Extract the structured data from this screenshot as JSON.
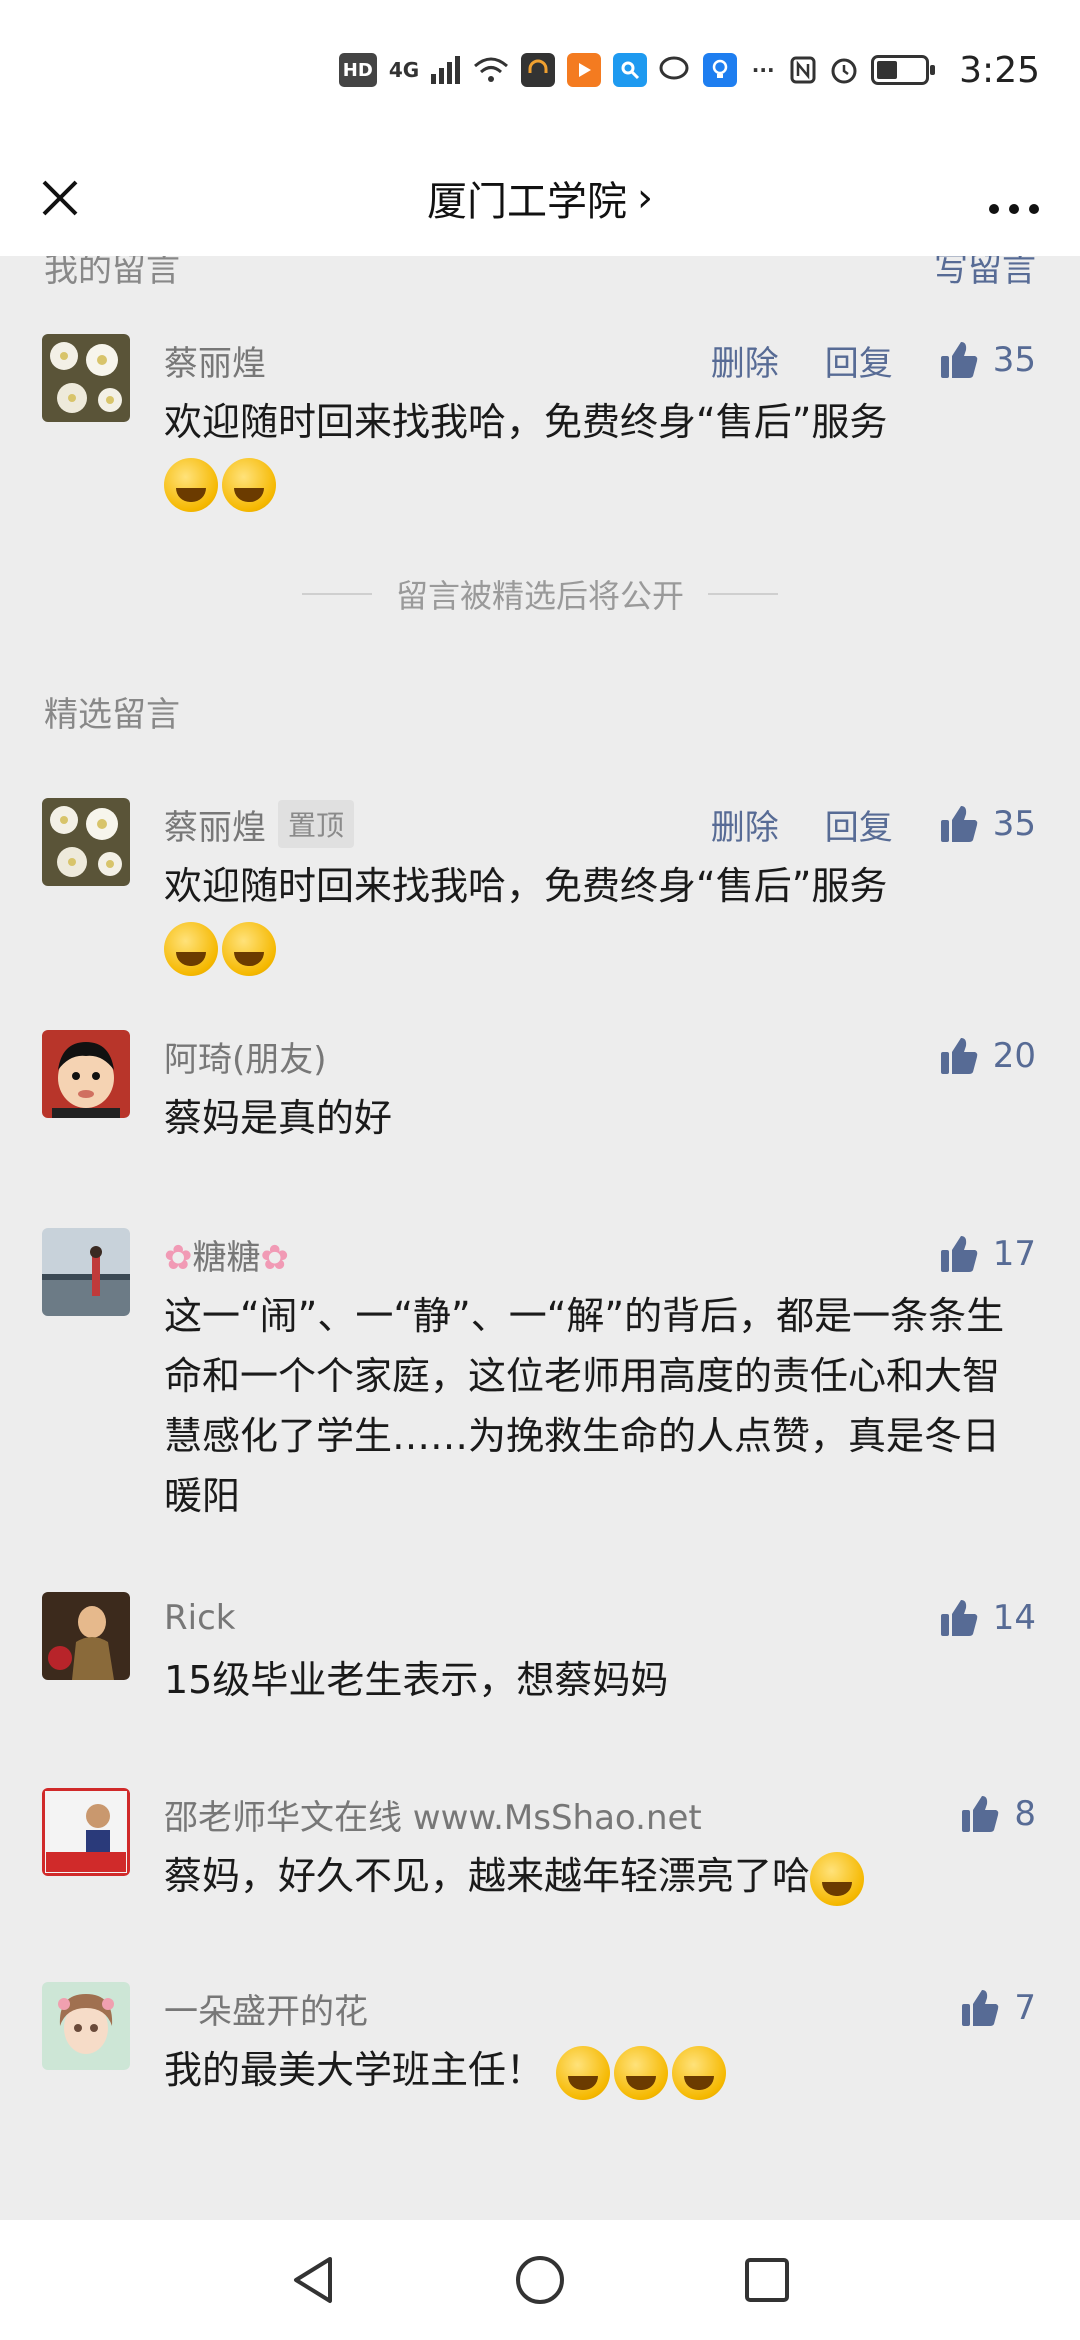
{
  "status_bar": {
    "network": "4G",
    "hd": "HD",
    "time": "3:25",
    "icons": [
      "hd-icon",
      "signal-icon",
      "wifi-icon",
      "headphones-icon",
      "video-icon",
      "search-app-icon",
      "chat-icon",
      "bulb-icon",
      "more-icon",
      "nfc-icon",
      "alarm-icon",
      "battery-icon"
    ]
  },
  "nav": {
    "title": "厦门工学院",
    "chevron": "›",
    "close_icon": "close-icon",
    "more_icon": "more-icon"
  },
  "my_section": {
    "title": "我的留言",
    "write_link": "写留言"
  },
  "my_comment": {
    "name": "蔡丽煌",
    "delete_label": "删除",
    "reply_label": "回复",
    "likes": "35",
    "text": "欢迎随时回来找我哈，免费终身“售后”服务"
  },
  "note": "留言被精选后将公开",
  "featured_section": {
    "title": "精选留言"
  },
  "comments": [
    {
      "name": "蔡丽煌",
      "tag": "置顶",
      "delete_label": "删除",
      "reply_label": "回复",
      "likes": "35",
      "text": "欢迎随时回来找我哈，免费终身“售后”服务"
    },
    {
      "name": "阿琦(朋友)",
      "likes": "20",
      "text": "蔡妈是真的好"
    },
    {
      "name": "糖糖",
      "likes": "17",
      "text": "这一“闹”、一“静”、一“解”的背后，都是一条条生命和一个个家庭，这位老师用高度的责任心和大智慧感化了学生……为挽救生命的人点赞，真是冬日暖阳"
    },
    {
      "name": "Rick",
      "likes": "14",
      "text": "15级毕业老生表示，想蔡妈妈"
    },
    {
      "name": "邵老师华文在线 www.MsShao.net",
      "likes": "8",
      "text": "蔡妈，好久不见，越来越年轻漂亮了哈"
    },
    {
      "name": "一朵盛开的花",
      "likes": "7",
      "text": "我的最美大学班主任！"
    }
  ],
  "colors": {
    "link": "#576b95",
    "background": "#ededed",
    "text": "#1a1a1a",
    "muted": "#888888"
  }
}
